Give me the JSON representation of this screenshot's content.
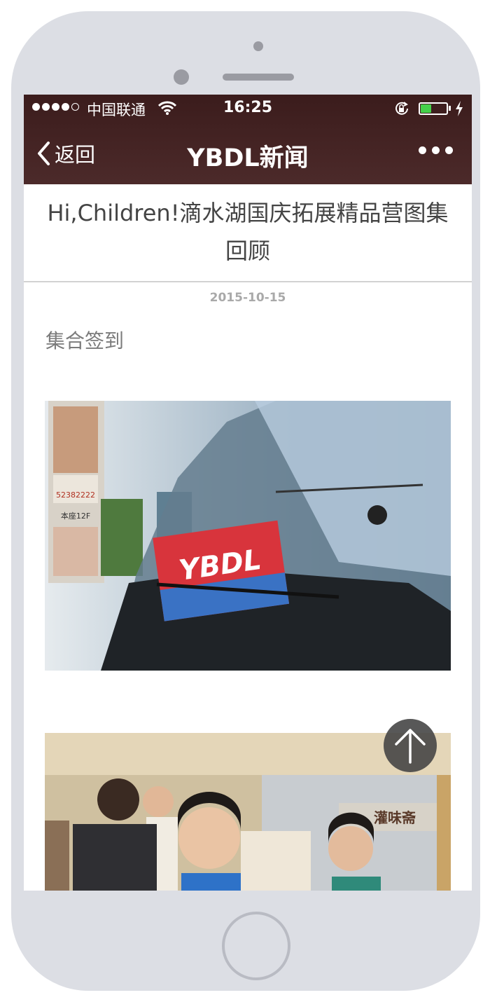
{
  "status_bar": {
    "carrier": "中国联通",
    "time": "16:25",
    "battery_level": 0.4,
    "signal_bars": 4
  },
  "nav": {
    "back_label": "返回",
    "title": "YBDL新闻"
  },
  "article": {
    "title": "Hi,Children!滴水湖国庆拓展精品营图集回顾",
    "date": "2015-10-15",
    "paragraph": "集合签到",
    "photo1": {
      "sign_text": "YBDL",
      "billboard_lines": [
        "52382222",
        "本座12F"
      ]
    },
    "photo2": {
      "shop_sign": "灌味斋"
    }
  },
  "colors": {
    "nav_bg": "#4a2828",
    "battery_green": "#45d04a",
    "title_text": "#444444",
    "date_text": "#a9a9a9"
  },
  "icons": {
    "back": "chevron-left-icon",
    "more": "more-dots-icon",
    "scroll_top": "arrow-up-icon",
    "wifi": "wifi-icon",
    "lock": "rotation-lock-icon",
    "bolt": "charging-icon"
  }
}
